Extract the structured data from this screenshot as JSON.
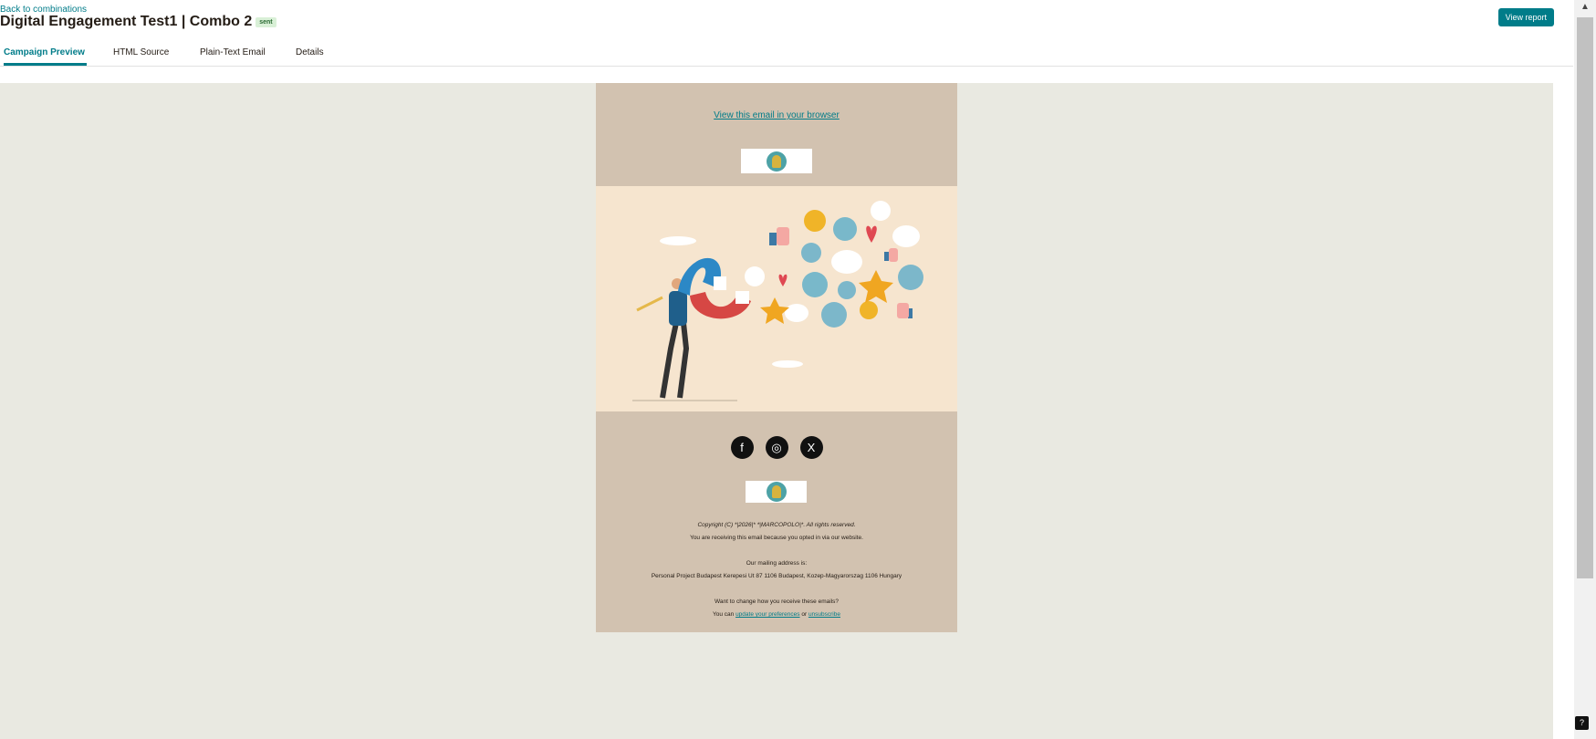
{
  "header": {
    "back_link": "Back to combinations",
    "title": "Digital Engagement Test1 | Combo 2",
    "badge": "sent",
    "view_report": "View report"
  },
  "tabs": [
    {
      "label": "Campaign Preview",
      "active": true
    },
    {
      "label": "HTML Source",
      "active": false
    },
    {
      "label": "Plain-Text Email",
      "active": false
    },
    {
      "label": "Details",
      "active": false
    }
  ],
  "email": {
    "view_in_browser": "View this email in your browser",
    "social": [
      {
        "icon": "facebook-icon",
        "glyph": "f"
      },
      {
        "icon": "instagram-icon",
        "glyph": "◎"
      },
      {
        "icon": "x-icon",
        "glyph": "X"
      }
    ],
    "copyright": "Copyright (C) *|2026|* *|MARCOPOLO|*. All rights reserved.",
    "receiving": "You are receiving this email because you opted in via our website.",
    "mailing_label": "Our mailing address is:",
    "address": "Personal Project Budapest Kerepesi Ut 87 1106 Budapest, Kozep-Magyarorszag 1106 Hungary",
    "change_prompt": "Want to change how you receive these emails?",
    "you_can": "You can",
    "update_preferences": "update your preferences",
    "or": "or",
    "unsubscribe": "unsubscribe"
  },
  "help": "?",
  "colors": {
    "accent": "#007c89",
    "email_bg": "#d2c2b0",
    "hero_bg": "#f6e5cf",
    "page_bg": "#e9e9e1"
  }
}
